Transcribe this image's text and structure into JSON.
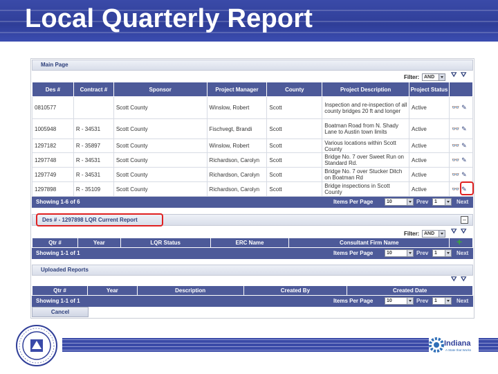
{
  "slide": {
    "title": "Local Quarterly Report",
    "footer_logo_text": "Indiana",
    "footer_logo_tagline": "A State that Works"
  },
  "main_page": {
    "section_label": "Main Page",
    "filter_label": "Filter:",
    "filter_value": "AND",
    "columns": [
      "Des #",
      "Contract #",
      "Sponsor",
      "Project Manager",
      "County",
      "Project Description",
      "Project Status"
    ],
    "rows": [
      {
        "des": "0810577",
        "contract": "",
        "sponsor": "Scott County",
        "manager": "Winslow, Robert",
        "county": "Scott",
        "description": "Inspection and re-inspection of all county bridges 20 ft and longer",
        "status": "Active"
      },
      {
        "des": "1005948",
        "contract": "R - 34531",
        "sponsor": "Scott County",
        "manager": "Fischvegt, Brandi",
        "county": "Scott",
        "description": "Boatman Road from N. Shady Lane to Austin town limits",
        "status": "Active"
      },
      {
        "des": "1297182",
        "contract": "R - 35897",
        "sponsor": "Scott County",
        "manager": "Winslow, Robert",
        "county": "Scott",
        "description": "Various locations within Scott County",
        "status": "Active"
      },
      {
        "des": "1297748",
        "contract": "R - 34531",
        "sponsor": "Scott County",
        "manager": "Richardson, Carolyn",
        "county": "Scott",
        "description": "Bridge No. 7 over Sweet Run on Standard Rd.",
        "status": "Active"
      },
      {
        "des": "1297749",
        "contract": "R - 34531",
        "sponsor": "Scott County",
        "manager": "Richardson, Carolyn",
        "county": "Scott",
        "description": "Bridge No. 7 over Stucker Ditch on Boatman Rd",
        "status": "Active"
      },
      {
        "des": "1297898",
        "contract": "R - 35109",
        "sponsor": "Scott County",
        "manager": "Richardson, Carolyn",
        "county": "Scott",
        "description": "Bridge inspections in Scott County",
        "status": "Active"
      }
    ],
    "showing": "Showing 1-6 of 6",
    "items_per_page_label": "Items Per Page",
    "items_per_page": "10",
    "prev_label": "Prev",
    "page": "1",
    "next_label": "Next"
  },
  "lqr": {
    "title": "Des # - 1297898 LQR Current Report",
    "filter_label": "Filter:",
    "filter_value": "AND",
    "columns": [
      "Qtr #",
      "Year",
      "LQR Status",
      "ERC Name",
      "Consultant Firm Name"
    ],
    "showing": "Showing 1-1 of 1",
    "items_per_page_label": "Items Per Page",
    "items_per_page": "10",
    "prev_label": "Prev",
    "page": "1",
    "next_label": "Next"
  },
  "uploaded": {
    "section_label": "Uploaded Reports",
    "columns": [
      "Qtr #",
      "Year",
      "Description",
      "Created By",
      "Created Date"
    ],
    "showing": "Showing 1-1 of 1",
    "items_per_page_label": "Items Per Page",
    "items_per_page": "10",
    "prev_label": "Prev",
    "page": "1",
    "next_label": "Next"
  },
  "cancel_label": "Cancel",
  "colors": {
    "header_blue": "#3a4aa8",
    "grid_header": "#4d5a99",
    "highlight_red": "#e02020"
  }
}
